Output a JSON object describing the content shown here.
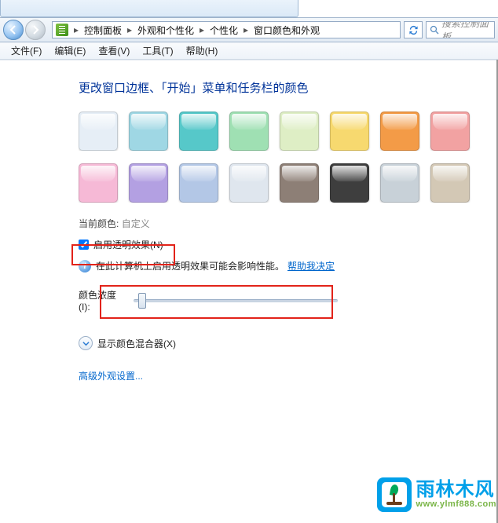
{
  "breadcrumb": {
    "items": [
      "控制面板",
      "外观和个性化",
      "个性化",
      "窗口颜色和外观"
    ]
  },
  "search": {
    "placeholder": "搜索控制面板"
  },
  "menu": {
    "file": "文件(F)",
    "edit": "编辑(E)",
    "view": "查看(V)",
    "tools": "工具(T)",
    "help": "帮助(H)"
  },
  "page": {
    "title": "更改窗口边框、「开始」菜单和任务栏的颜色",
    "current_color_label": "当前颜色:",
    "current_color_value": "自定义",
    "enable_transparency": "启用透明效果(N)",
    "info_text": "在此计算机上启用透明效果可能会影响性能。",
    "info_link": "帮助我决定",
    "intensity_label": "颜色浓度(I):",
    "mixer_label": "显示颜色混合器(X)",
    "advanced_link": "高级外观设置..."
  },
  "swatches_row1": [
    "#e6eef6",
    "#9fd7e4",
    "#56c8c9",
    "#9fe0b3",
    "#deeec5",
    "#f7d96f",
    "#f39b47",
    "#f2a2a2"
  ],
  "swatches_row2": [
    "#f6b9d6",
    "#b3a0e2",
    "#b3c7e6",
    "#dfe6ee",
    "#8d7f76",
    "#3e3e3e",
    "#c8d1d8",
    "#d3c8b5"
  ],
  "watermark": {
    "cn": "雨林木风",
    "en": "www.ylmf888.com"
  }
}
